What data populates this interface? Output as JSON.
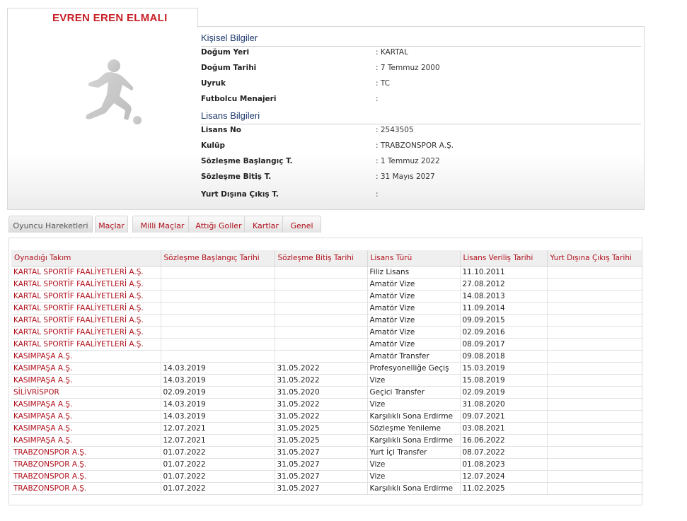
{
  "player": {
    "name": "EVREN EREN ELMALI",
    "photo_icon": "soccer-player-silhouette-icon"
  },
  "personal": {
    "title": "Kişisel Bilgiler",
    "fields": [
      {
        "label": "Doğum Yeri",
        "value": ":  KARTAL"
      },
      {
        "label": "Doğum Tarihi",
        "value": ":  7 Temmuz 2000"
      },
      {
        "label": "Uyruk",
        "value": ":  TC"
      },
      {
        "label": "Futbolcu Menajeri",
        "value": ":"
      }
    ]
  },
  "license": {
    "title": "Lisans Bilgileri",
    "fields": [
      {
        "label": "Lisans No",
        "value": ": 2543505"
      },
      {
        "label": "Kulüp",
        "value": ": TRABZONSPOR A.Ş."
      },
      {
        "label": "Sözleşme Başlangıç T.",
        "value": ": 1 Temmuz 2022"
      },
      {
        "label": "Sözleşme Bitiş T.",
        "value": ": 31 Mayıs 2027"
      },
      {
        "label": "Yurt Dışına Çıkış T.",
        "value": ":"
      }
    ]
  },
  "tabs": [
    "Oyuncu Hareketleri",
    "Maçlar",
    "Milli Maçlar",
    "Attığı Goller",
    "Kartlar",
    "Genel"
  ],
  "active_tab": "Oyuncu Hareketleri",
  "colors": {
    "accent": "#b0101c",
    "name": "#c81f26",
    "section_title": "#1f3a6e"
  },
  "table": {
    "headers": [
      "Oynadığı Takım",
      "Sözleşme Başlangıç Tarihi",
      "Sözleşme Bitiş Tarihi",
      "Lisans Türü",
      "Lisans Veriliş Tarihi",
      "Yurt Dışına Çıkış Tarihi"
    ],
    "rows": [
      [
        "KARTAL SPORTİF FAALİYETLERİ A.Ş.",
        "",
        "",
        "Filiz Lisans",
        "11.10.2011",
        ""
      ],
      [
        "KARTAL SPORTİF FAALİYETLERİ A.Ş.",
        "",
        "",
        "Amatör Vize",
        "27.08.2012",
        ""
      ],
      [
        "KARTAL SPORTİF FAALİYETLERİ A.Ş.",
        "",
        "",
        "Amatör Vize",
        "14.08.2013",
        ""
      ],
      [
        "KARTAL SPORTİF FAALİYETLERİ A.Ş.",
        "",
        "",
        "Amatör Vize",
        "11.09.2014",
        ""
      ],
      [
        "KARTAL SPORTİF FAALİYETLERİ A.Ş.",
        "",
        "",
        "Amatör Vize",
        "09.09.2015",
        ""
      ],
      [
        "KARTAL SPORTİF FAALİYETLERİ A.Ş.",
        "",
        "",
        "Amatör Vize",
        "02.09.2016",
        ""
      ],
      [
        "KARTAL SPORTİF FAALİYETLERİ A.Ş.",
        "",
        "",
        "Amatör Vize",
        "08.09.2017",
        ""
      ],
      [
        "KASIMPAŞA A.Ş.",
        "",
        "",
        "Amatör Transfer",
        "09.08.2018",
        ""
      ],
      [
        "KASIMPAŞA A.Ş.",
        "14.03.2019",
        "31.05.2022",
        "Profesyonelliğe Geçiş",
        "15.03.2019",
        ""
      ],
      [
        "KASIMPAŞA A.Ş.",
        "14.03.2019",
        "31.05.2022",
        "Vize",
        "15.08.2019",
        ""
      ],
      [
        "SİLİVRİSPOR",
        "02.09.2019",
        "31.05.2020",
        "Geçici Transfer",
        "02.09.2019",
        ""
      ],
      [
        "KASIMPAŞA A.Ş.",
        "14.03.2019",
        "31.05.2022",
        "Vize",
        "31.08.2020",
        ""
      ],
      [
        "KASIMPAŞA A.Ş.",
        "14.03.2019",
        "31.05.2022",
        "Karşılıklı Sona Erdirme",
        "09.07.2021",
        ""
      ],
      [
        "KASIMPAŞA A.Ş.",
        "12.07.2021",
        "31.05.2025",
        "Sözleşme Yenileme",
        "03.08.2021",
        ""
      ],
      [
        "KASIMPAŞA A.Ş.",
        "12.07.2021",
        "31.05.2025",
        "Karşılıklı Sona Erdirme",
        "16.06.2022",
        ""
      ],
      [
        "TRABZONSPOR A.Ş.",
        "01.07.2022",
        "31.05.2027",
        "Yurt İçi Transfer",
        "08.07.2022",
        ""
      ],
      [
        "TRABZONSPOR A.Ş.",
        "01.07.2022",
        "31.05.2027",
        "Vize",
        "01.08.2023",
        ""
      ],
      [
        "TRABZONSPOR A.Ş.",
        "01.07.2022",
        "31.05.2027",
        "Vize",
        "12.07.2024",
        ""
      ],
      [
        "TRABZONSPOR A.Ş.",
        "01.07.2022",
        "31.05.2027",
        "Karşılıklı Sona Erdirme",
        "11.02.2025",
        ""
      ]
    ]
  }
}
